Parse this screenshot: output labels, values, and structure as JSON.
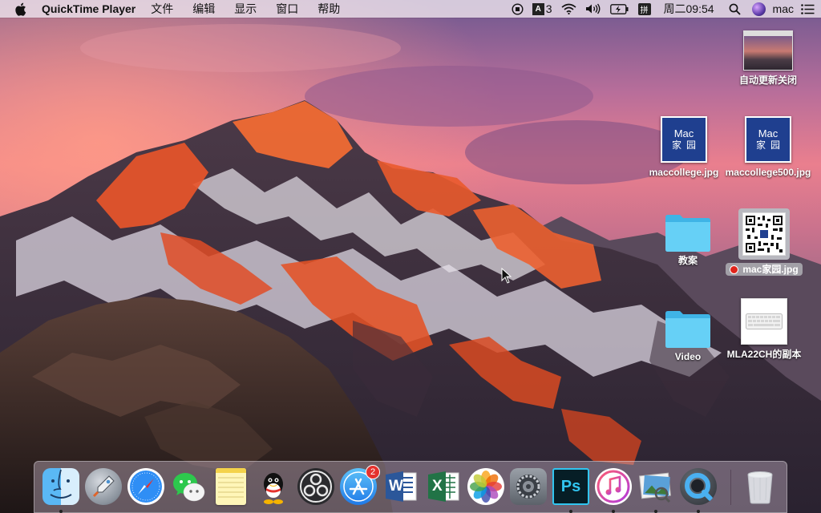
{
  "menubar": {
    "app_name": "QuickTime Player",
    "menus": [
      "文件",
      "编辑",
      "显示",
      "窗口",
      "帮助"
    ],
    "status": {
      "ai_count": "3",
      "ime_label": "拼",
      "clock": "周二09:54",
      "user": "mac"
    }
  },
  "desktop": {
    "icons": [
      {
        "label": "自动更新关闭"
      },
      {
        "label": "maccollege.jpg",
        "tile_line1": "Mac",
        "tile_line2": "家园"
      },
      {
        "label": "maccollege500.jpg",
        "tile_line1": "Mac",
        "tile_line2": "家园"
      },
      {
        "label": "教案"
      },
      {
        "label": "mac家园.jpg"
      },
      {
        "label": "Video"
      },
      {
        "label": "MLA22CH的副本"
      }
    ]
  },
  "dock": {
    "apps": [
      {
        "icon": "finder-icon",
        "running": true
      },
      {
        "icon": "launchpad-icon",
        "running": false
      },
      {
        "icon": "safari-icon",
        "running": false
      },
      {
        "icon": "wechat-icon",
        "running": false
      },
      {
        "icon": "notes-icon",
        "running": false
      },
      {
        "icon": "qq-icon",
        "running": false
      },
      {
        "icon": "obs-icon",
        "running": false
      },
      {
        "icon": "app-store-icon",
        "running": false,
        "badge": "2"
      },
      {
        "icon": "word-icon",
        "running": false
      },
      {
        "icon": "excel-icon",
        "running": false
      },
      {
        "icon": "photos-icon",
        "running": false
      },
      {
        "icon": "system-preferences-icon",
        "running": false
      },
      {
        "icon": "photoshop-icon",
        "running": true
      },
      {
        "icon": "itunes-icon",
        "running": true
      },
      {
        "icon": "preview-icon",
        "running": true
      },
      {
        "icon": "quicktime-icon",
        "running": true
      },
      {
        "icon": "trash-icon",
        "running": false
      }
    ],
    "photoshop_label": "Ps",
    "word_label": "W",
    "excel_label": "X"
  },
  "colors": {
    "sky_top": "#7c5a93",
    "sky_glow": "#e8788a",
    "peak_orange": "#e8552a",
    "rock_dark": "#3b2a28",
    "folder_blue": "#5ec8f2",
    "mac_tile_blue": "#1f3f8f"
  }
}
